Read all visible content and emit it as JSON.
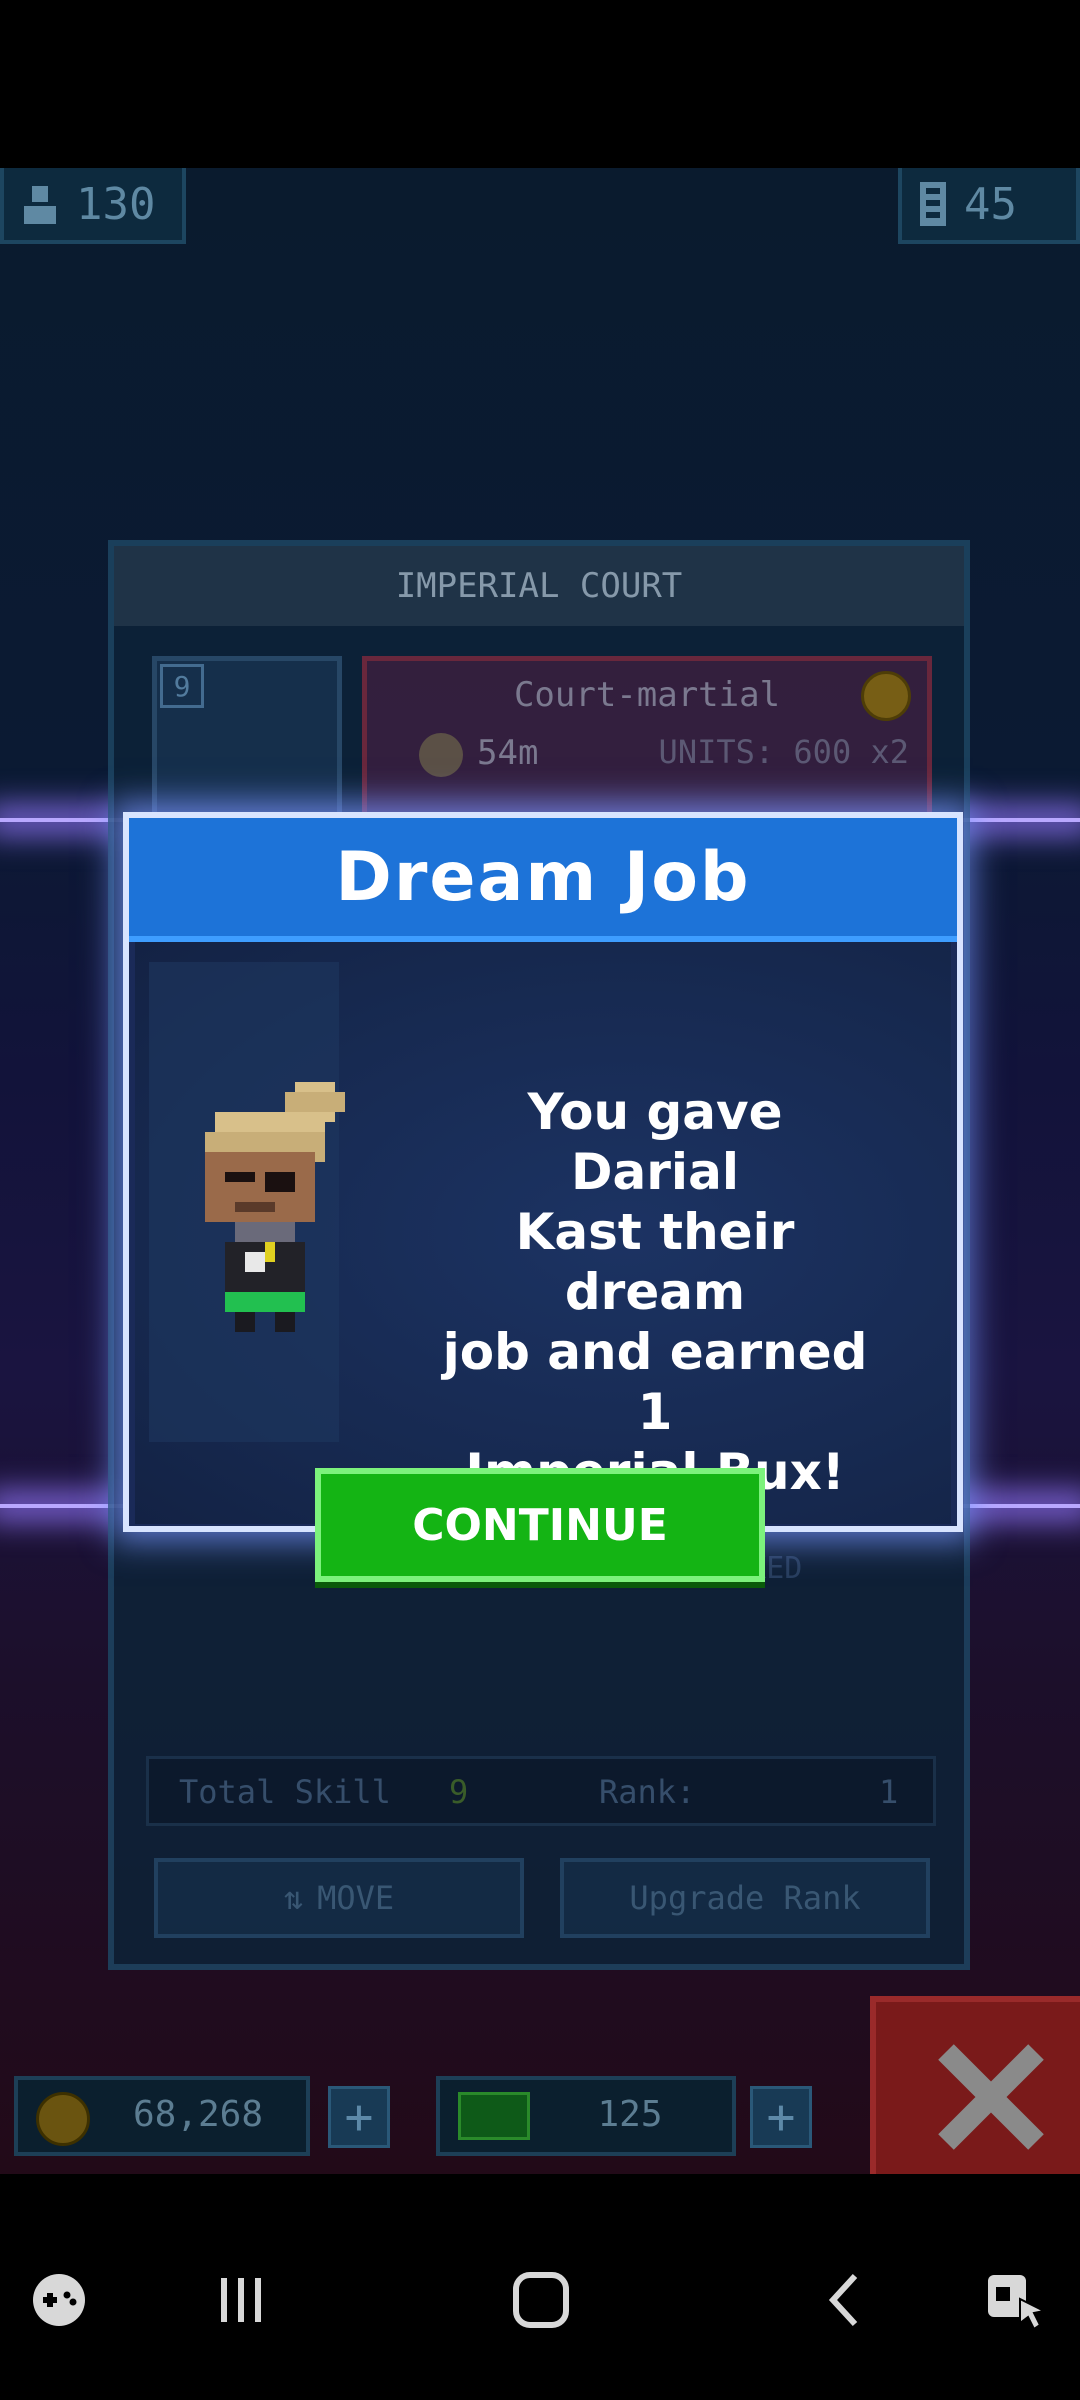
{
  "hud": {
    "population": "130",
    "floors": "45"
  },
  "panel": {
    "title": "IMPERIAL COURT",
    "level": "9",
    "job_name": "Court-martial",
    "job_time": "54m",
    "job_units": "UNITS: 600 x2",
    "items_locked": "ITEMS LOCKED",
    "total_skill_label": "Total Skill",
    "total_skill_value": "9",
    "rank_label": "Rank:",
    "rank_value": "1",
    "move_label": "MOVE",
    "upgrade_label": "Upgrade Rank"
  },
  "dialog": {
    "title": "Dream Job",
    "message_lines": [
      "You gave Darial",
      "Kast their dream",
      "job and earned 1",
      "Imperial Bux!"
    ],
    "continue_label": "CONTINUE"
  },
  "currency": {
    "coins": "68,268",
    "bux": "125"
  },
  "colors": {
    "dialog_header": "#1d73d8",
    "continue_button": "#14b414",
    "background": "#0b1a33"
  },
  "icons": {
    "population": "person-icon",
    "floors": "building-icon",
    "coin": "coin-icon",
    "bux": "bux-icon",
    "close": "close-icon",
    "nav": [
      "game-launcher-icon",
      "recent-apps-icon",
      "home-icon",
      "back-icon",
      "accessibility-icon"
    ]
  }
}
